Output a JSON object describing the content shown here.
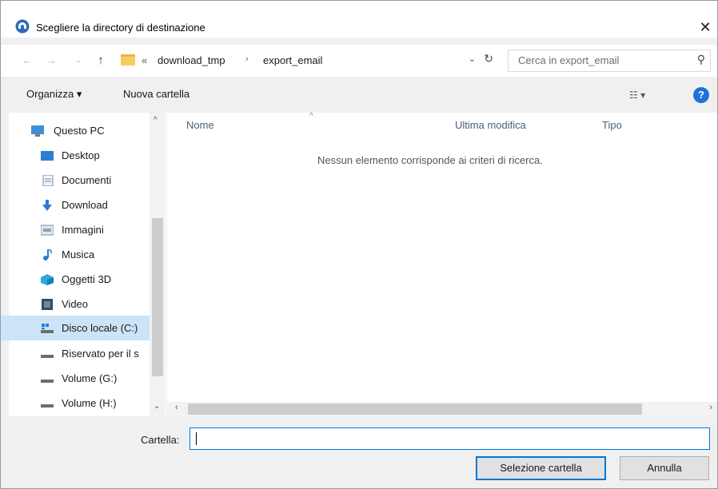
{
  "dialog": {
    "title": "Scegliere la directory di destinazione",
    "close_glyph": "✕"
  },
  "nav": {
    "back_glyph": "←",
    "forward_glyph": "→",
    "recent_glyph": "⌄",
    "up_glyph": "↑",
    "overflow_glyph": "«",
    "crumbs": [
      "download_tmp",
      "export_email"
    ],
    "crumb_sep": "›",
    "dropdown_glyph": "⌄",
    "refresh_glyph": "↻"
  },
  "search": {
    "placeholder": "Cerca in export_email",
    "icon_glyph": "⚲"
  },
  "toolbar": {
    "organize_label": "Organizza ▾",
    "new_folder_label": "Nuova cartella",
    "view_glyph": "☷ ▾",
    "help_glyph": "?"
  },
  "navpane": {
    "items": [
      {
        "label": "Questo PC",
        "icon": "pc-icon"
      },
      {
        "label": "Desktop",
        "icon": "desktop-icon"
      },
      {
        "label": "Documenti",
        "icon": "documents-icon"
      },
      {
        "label": "Download",
        "icon": "download-icon"
      },
      {
        "label": "Immagini",
        "icon": "pictures-icon"
      },
      {
        "label": "Musica",
        "icon": "music-icon"
      },
      {
        "label": "Oggetti 3D",
        "icon": "objects-3d-icon"
      },
      {
        "label": "Video",
        "icon": "video-icon"
      },
      {
        "label": "Disco locale (C:)",
        "icon": "local-disk-icon",
        "selected": true
      },
      {
        "label": "Riservato per il s",
        "icon": "drive-icon"
      },
      {
        "label": "Volume (G:)",
        "icon": "drive-icon"
      },
      {
        "label": "Volume (H:)",
        "icon": "drive-icon"
      }
    ],
    "scroll_up_glyph": "^",
    "scroll_down_glyph": "⌄"
  },
  "filelist": {
    "columns": [
      "Nome",
      "Ultima modifica",
      "Tipo"
    ],
    "sort_glyph": "^",
    "empty_message": "Nessun elemento corrisponde ai criteri di ricerca.",
    "hscroll_left_glyph": "‹",
    "hscroll_right_glyph": "›"
  },
  "footer": {
    "folder_label": "Cartella:",
    "folder_value": "",
    "select_label": "Selezione cartella",
    "cancel_label": "Annulla"
  },
  "colors": {
    "accent": "#0078d7",
    "selection": "#cce4f7",
    "help": "#1e72d6"
  }
}
